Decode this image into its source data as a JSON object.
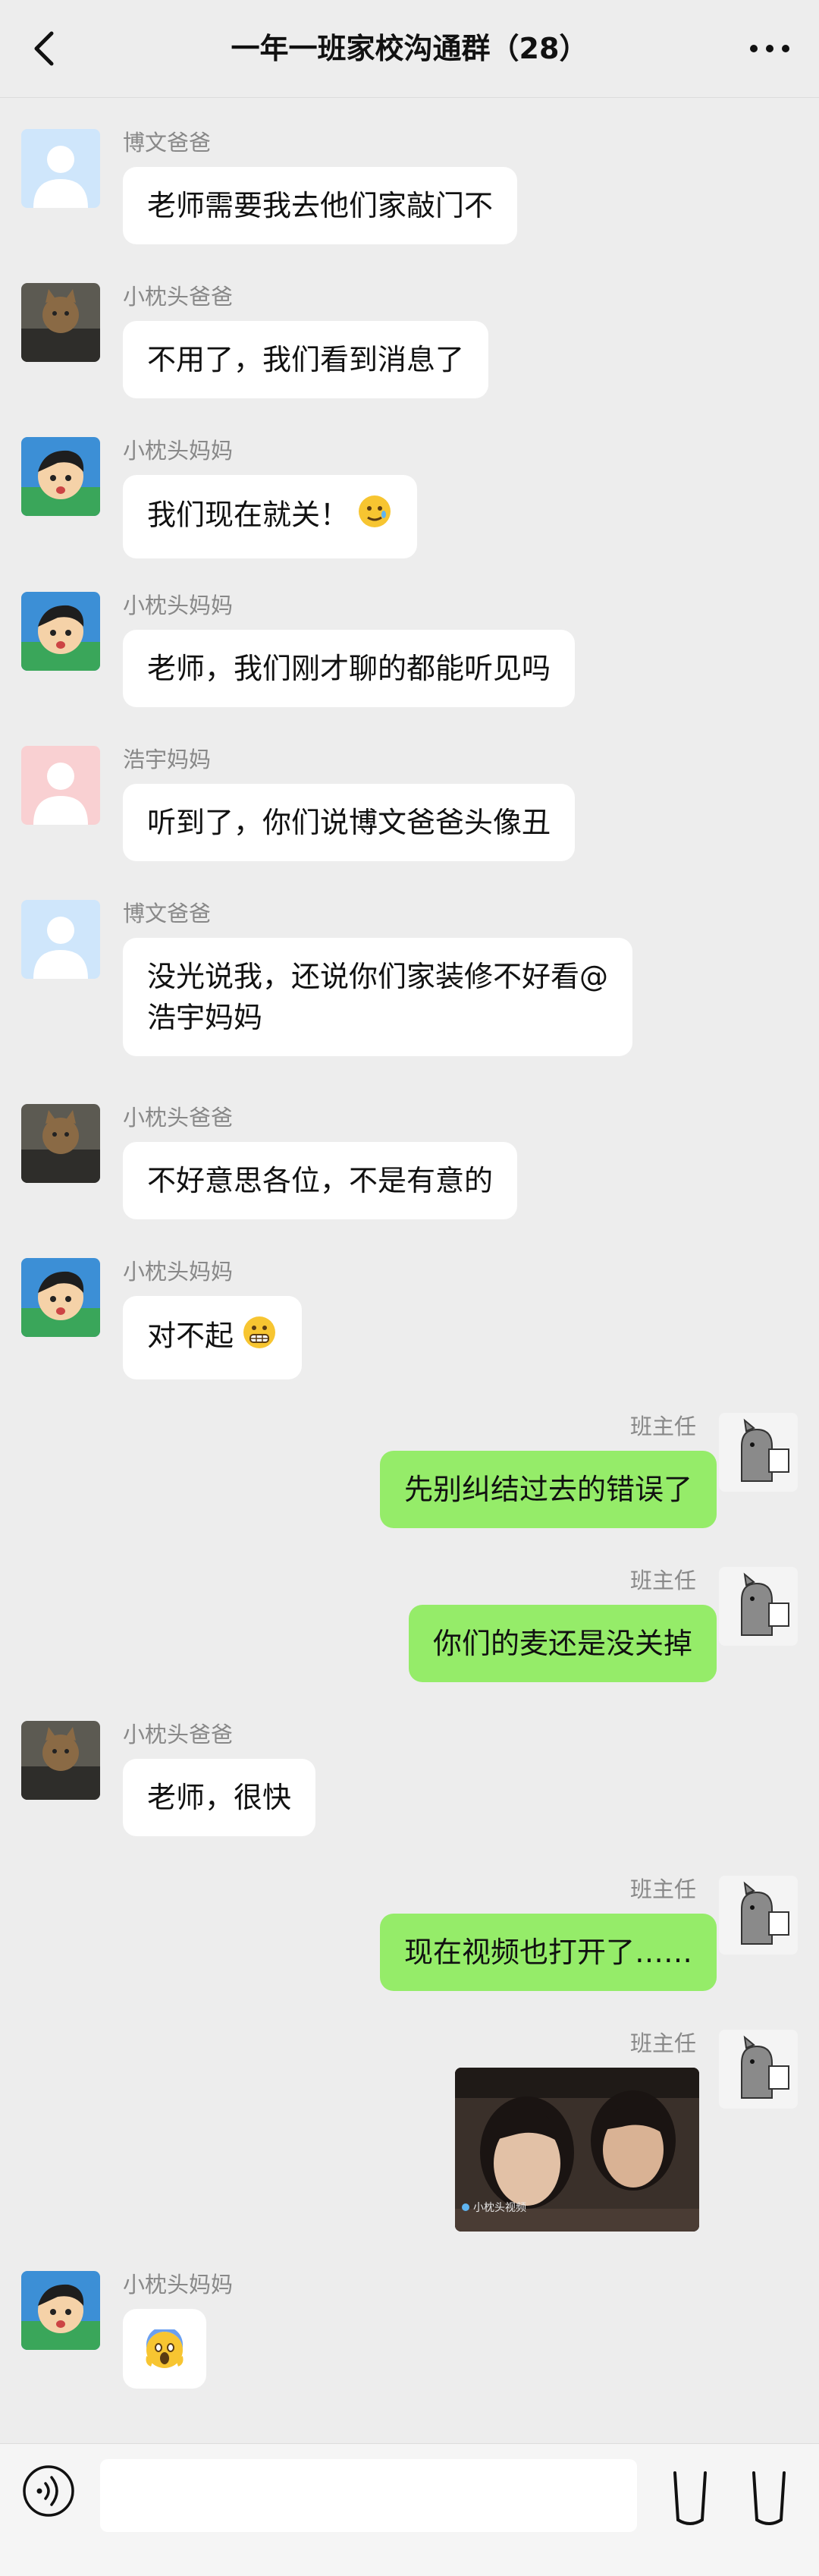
{
  "header": {
    "title": "一年一班家校沟通群（28）",
    "back_icon": "chevron-left-icon",
    "more_icon": "more-dots-icon"
  },
  "messages": [
    {
      "sender": "博文爸爸",
      "side": "left",
      "avatar": "default-avatar-blue",
      "text": "老师需要我去他们家敲门不"
    },
    {
      "sender": "小枕头爸爸",
      "side": "left",
      "avatar": "cat-avatar",
      "text": "不用了，我们看到消息了"
    },
    {
      "sender": "小枕头妈妈",
      "side": "left",
      "avatar": "cartoon-boy-avatar",
      "text": "我们现在就关！",
      "emoji": "teary-smile-emoji"
    },
    {
      "sender": "小枕头妈妈",
      "side": "left",
      "avatar": "cartoon-boy-avatar",
      "text": "老师，我们刚才聊的都能听见吗"
    },
    {
      "sender": "浩宇妈妈",
      "side": "left",
      "avatar": "default-avatar-pink",
      "text": "听到了，你们说博文爸爸头像丑"
    },
    {
      "sender": "博文爸爸",
      "side": "left",
      "avatar": "default-avatar-blue",
      "text_line1": "没光说我，还说你们家装修不好看@",
      "text_line2": "浩宇妈妈"
    },
    {
      "sender": "小枕头爸爸",
      "side": "left",
      "avatar": "cat-avatar",
      "text": "不好意思各位，不是有意的"
    },
    {
      "sender": "小枕头妈妈",
      "side": "left",
      "avatar": "cartoon-boy-avatar",
      "text": "对不起",
      "emoji": "grimace-emoji"
    },
    {
      "sender": "班主任",
      "side": "right",
      "avatar": "doodle-animal-avatar",
      "text": "先别纠结过去的错误了"
    },
    {
      "sender": "班主任",
      "side": "right",
      "avatar": "doodle-animal-avatar",
      "text": "你们的麦还是没关掉"
    },
    {
      "sender": "小枕头爸爸",
      "side": "left",
      "avatar": "cat-avatar",
      "text": "老师，很快"
    },
    {
      "sender": "班主任",
      "side": "right",
      "avatar": "doodle-animal-avatar",
      "text": "现在视频也打开了……"
    },
    {
      "sender": "班主任",
      "side": "right",
      "avatar": "doodle-animal-avatar",
      "video": "video-thumbnail",
      "video_caption": "小枕头视频"
    },
    {
      "sender": "小枕头妈妈",
      "side": "left",
      "avatar": "cartoon-boy-avatar",
      "emoji": "screaming-fear-emoji"
    }
  ],
  "bottom_bar": {
    "voice_icon": "voice-icon",
    "input_value": "",
    "input_placeholder": "",
    "emoji_icon": "emoji-icon",
    "plus_icon": "plus-icon"
  }
}
